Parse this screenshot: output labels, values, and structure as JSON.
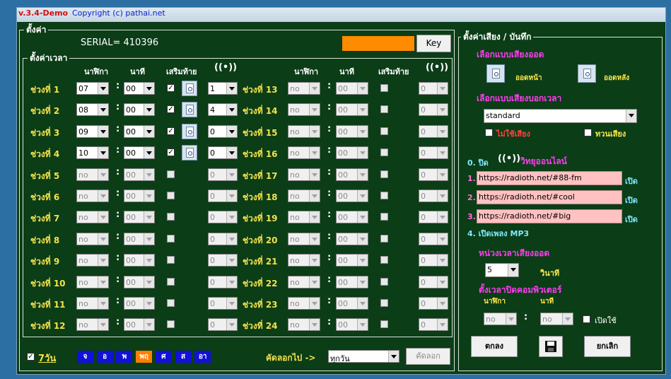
{
  "title_bar": {
    "version": "v.3.4-Demo",
    "copyright": "Copyright (c) pathai.net"
  },
  "settings": {
    "group_title": "ตั้งค่า",
    "serial": "SERIAL= 410396",
    "key_button": "Key",
    "time_group_title": "ตั้งค่าเวลา",
    "headers": {
      "hour": "นาฬิกา",
      "minute": "นาที",
      "extra": "เสริมท้าย"
    },
    "slots_left": [
      {
        "label": "ช่วงที่ 1",
        "hour": "07",
        "minute": "00",
        "checked": true,
        "count": "1",
        "enabled": true
      },
      {
        "label": "ช่วงที่ 2",
        "hour": "08",
        "minute": "00",
        "checked": true,
        "count": "4",
        "enabled": true
      },
      {
        "label": "ช่วงที่ 3",
        "hour": "09",
        "minute": "00",
        "checked": true,
        "count": "0",
        "enabled": true
      },
      {
        "label": "ช่วงที่ 4",
        "hour": "10",
        "minute": "00",
        "checked": true,
        "count": "0",
        "enabled": true
      },
      {
        "label": "ช่วงที่ 5",
        "hour": "no",
        "minute": "00",
        "checked": false,
        "count": "0",
        "enabled": false
      },
      {
        "label": "ช่วงที่ 6",
        "hour": "no",
        "minute": "00",
        "checked": false,
        "count": "0",
        "enabled": false
      },
      {
        "label": "ช่วงที่ 7",
        "hour": "no",
        "minute": "00",
        "checked": false,
        "count": "0",
        "enabled": false
      },
      {
        "label": "ช่วงที่ 8",
        "hour": "no",
        "minute": "00",
        "checked": false,
        "count": "0",
        "enabled": false
      },
      {
        "label": "ช่วงที่ 9",
        "hour": "no",
        "minute": "00",
        "checked": false,
        "count": "0",
        "enabled": false
      },
      {
        "label": "ช่วงที่ 10",
        "hour": "no",
        "minute": "00",
        "checked": false,
        "count": "0",
        "enabled": false
      },
      {
        "label": "ช่วงที่ 11",
        "hour": "no",
        "minute": "00",
        "checked": false,
        "count": "0",
        "enabled": false
      },
      {
        "label": "ช่วงที่ 12",
        "hour": "no",
        "minute": "00",
        "checked": false,
        "count": "0",
        "enabled": false
      }
    ],
    "slots_right": [
      {
        "label": "ช่วงที่ 13",
        "hour": "no",
        "minute": "00",
        "checked": false,
        "count": "0"
      },
      {
        "label": "ช่วงที่ 14",
        "hour": "no",
        "minute": "00",
        "checked": false,
        "count": "0"
      },
      {
        "label": "ช่วงที่ 15",
        "hour": "no",
        "minute": "00",
        "checked": false,
        "count": "0"
      },
      {
        "label": "ช่วงที่ 16",
        "hour": "no",
        "minute": "00",
        "checked": false,
        "count": "0"
      },
      {
        "label": "ช่วงที่ 17",
        "hour": "no",
        "minute": "00",
        "checked": false,
        "count": "0"
      },
      {
        "label": "ช่วงที่ 18",
        "hour": "no",
        "minute": "00",
        "checked": false,
        "count": "0"
      },
      {
        "label": "ช่วงที่ 19",
        "hour": "no",
        "minute": "00",
        "checked": false,
        "count": "0"
      },
      {
        "label": "ช่วงที่ 20",
        "hour": "no",
        "minute": "00",
        "checked": false,
        "count": "0"
      },
      {
        "label": "ช่วงที่ 21",
        "hour": "no",
        "minute": "00",
        "checked": false,
        "count": "0"
      },
      {
        "label": "ช่วงที่ 22",
        "hour": "no",
        "minute": "00",
        "checked": false,
        "count": "0"
      },
      {
        "label": "ช่วงที่ 23",
        "hour": "no",
        "minute": "00",
        "checked": false,
        "count": "0"
      },
      {
        "label": "ช่วงที่ 24",
        "hour": "no",
        "minute": "00",
        "checked": false,
        "count": "0"
      }
    ]
  },
  "bottom": {
    "seven_days": "7วัน",
    "seven_days_checked": true,
    "days": [
      {
        "label": "จ",
        "color": "#1111d8"
      },
      {
        "label": "อ",
        "color": "#1111d8"
      },
      {
        "label": "พ",
        "color": "#1111d8"
      },
      {
        "label": "พฤ",
        "color": "#ff7f00"
      },
      {
        "label": "ศ",
        "color": "#1111d8"
      },
      {
        "label": "ส",
        "color": "#1111d8"
      },
      {
        "label": "อา",
        "color": "#1111d8"
      }
    ],
    "copy_to_label": "คัดลอกไป ->",
    "copy_to_value": "ทุกวัน",
    "copy_button": "คัดลอก"
  },
  "sound": {
    "group_title": "ตั้งค่าเสียง / บันทึก",
    "select_voice": "เลือกแบบเสียงออด",
    "before_label": "ออดหน้า",
    "after_label": "ออดหลัง",
    "select_time_voice": "เลือกแบบเสียงบอกเวลา",
    "voice_value": "standard",
    "no_voice": "ไม่ใช้เสียง",
    "mix_voice": "ทวนเสียง",
    "radio_off": "0. ปิด",
    "radio_online": "วิทยุออนไลน์",
    "stations": [
      {
        "num": "1.",
        "url": "https://radioth.net/#88-fm",
        "action": "เปิด"
      },
      {
        "num": "2.",
        "url": "https://radioth.net/#cool",
        "action": "เปิด"
      },
      {
        "num": "3.",
        "url": "https://radioth.net/#big",
        "action": "เปิด"
      }
    ],
    "mp3": "4. เปิดเพลง MP3",
    "delay_title": "หน่วงเวลาเสียงออด",
    "delay_value": "5",
    "delay_unit": "วินาที",
    "shutdown_title": "ตั้งเวลาปิดคอมพิวเตอร์",
    "shutdown_hour_hdr": "นาฬิกา",
    "shutdown_min_hdr": "นาที",
    "shutdown_hour": "no",
    "shutdown_min": "no",
    "enable_label": "เปิดใช้",
    "ok_button": "ตกลง",
    "cancel_button": "ยกเลิก"
  },
  "colors": {
    "panel_bg": "#0b3d17",
    "label_yellow": "#f5e14a",
    "magenta": "#ff3cf0",
    "key_orange": "#ff8c00"
  }
}
